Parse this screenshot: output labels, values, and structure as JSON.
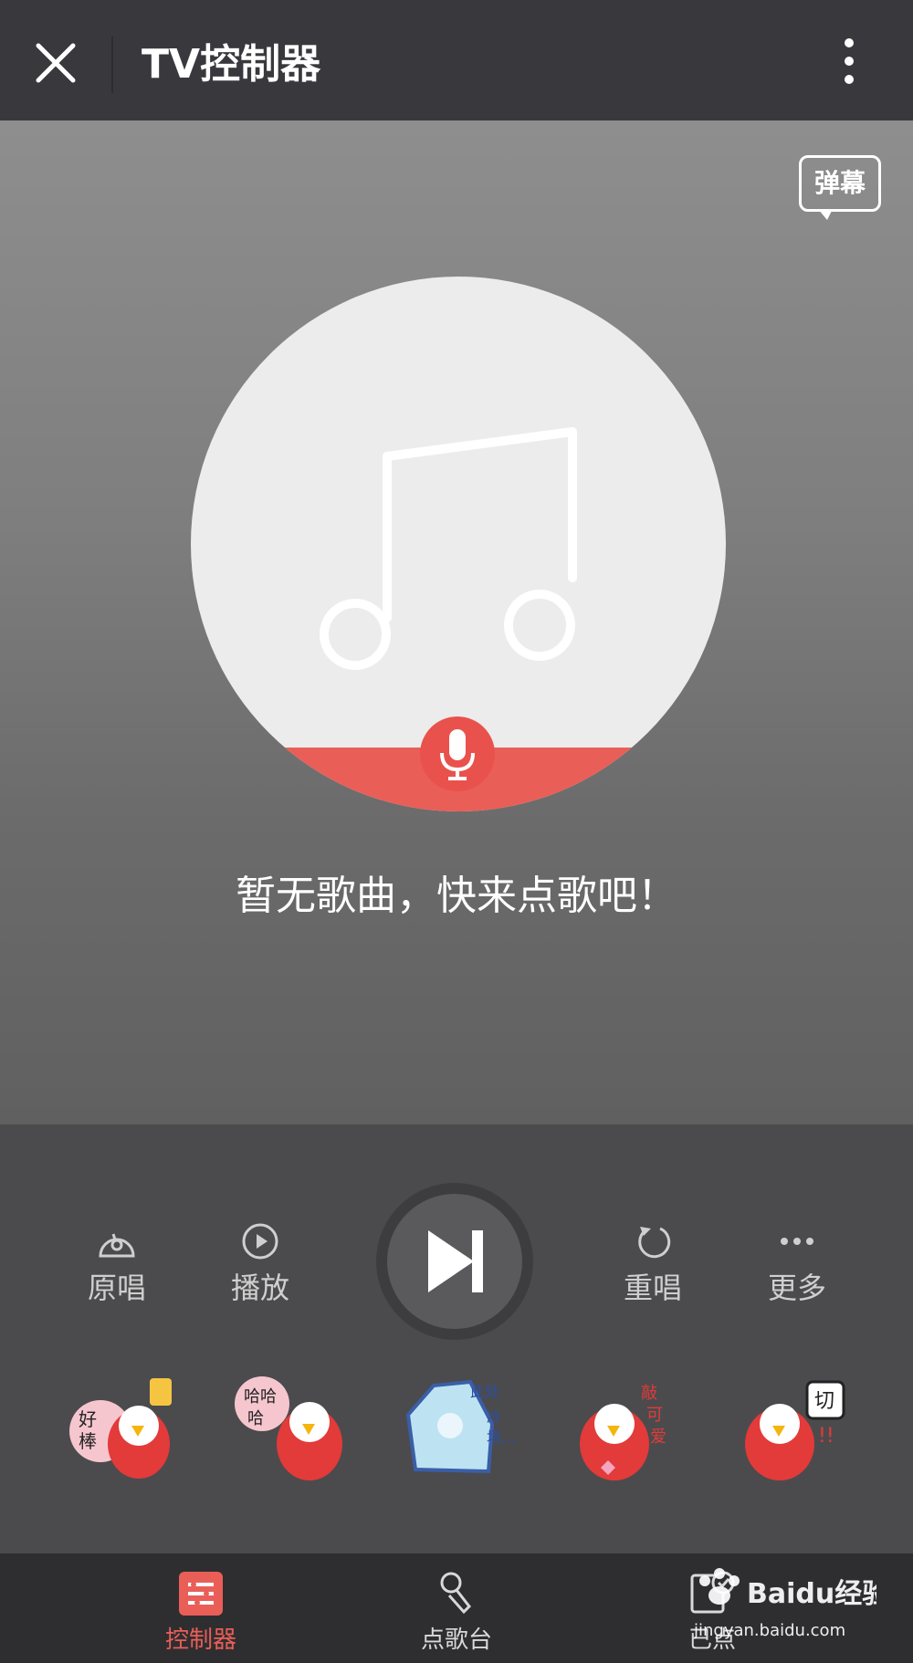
{
  "header": {
    "title": "TV控制器"
  },
  "danmu": {
    "label": "弹幕"
  },
  "player": {
    "empty_message": "暂无歌曲，快来点歌吧！"
  },
  "controls": {
    "original": "原唱",
    "play": "播放",
    "replay": "重唱",
    "more": "更多"
  },
  "stickers": [
    {
      "text": "好棒"
    },
    {
      "text": "哈哈哈"
    },
    {
      "text": "此处冷场…"
    },
    {
      "text": "敲可爱"
    },
    {
      "text": "切!!"
    }
  ],
  "tabs": [
    {
      "label": "控制器",
      "active": true
    },
    {
      "label": "点歌台",
      "active": false
    },
    {
      "label": "已点",
      "active": false
    }
  ],
  "watermark": {
    "brand": "Baidu经验",
    "url": "jingyan.baidu.com"
  },
  "colors": {
    "accent": "#ea5e58",
    "topbar": "#38383d",
    "tabbar": "#2e2e30"
  }
}
